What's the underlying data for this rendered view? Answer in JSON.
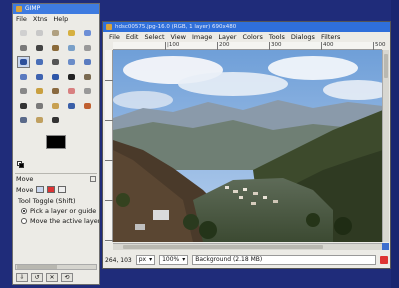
{
  "toolbox": {
    "title": "GIMP",
    "menu": [
      "File",
      "Xtns",
      "Help"
    ],
    "tools": [
      {
        "name": "rect-select-icon",
        "color": "#d0d0d0"
      },
      {
        "name": "ellipse-select-icon",
        "color": "#c8c8c8"
      },
      {
        "name": "lasso-icon",
        "color": "#b0a080"
      },
      {
        "name": "fuzzy-select-icon",
        "color": "#d6b040"
      },
      {
        "name": "select-by-color-icon",
        "color": "#6d8fd6"
      },
      {
        "name": "scissors-icon",
        "color": "#7a7a7a"
      },
      {
        "name": "paths-icon",
        "color": "#444"
      },
      {
        "name": "color-picker-icon",
        "color": "#8b6a3a"
      },
      {
        "name": "zoom-icon",
        "color": "#7aa0c8"
      },
      {
        "name": "measure-icon",
        "color": "#999"
      },
      {
        "name": "move-icon",
        "color": "#2d4f9a"
      },
      {
        "name": "align-icon",
        "color": "#4a6fb8"
      },
      {
        "name": "crop-icon",
        "color": "#555"
      },
      {
        "name": "rotate-icon",
        "color": "#6a8cc8"
      },
      {
        "name": "scale-icon",
        "color": "#5b7cc0"
      },
      {
        "name": "shear-icon",
        "color": "#5a7ac0"
      },
      {
        "name": "perspective-icon",
        "color": "#3e63b0"
      },
      {
        "name": "flip-icon",
        "color": "#2e56a8"
      },
      {
        "name": "text-icon",
        "color": "#222"
      },
      {
        "name": "bucket-fill-icon",
        "color": "#7a6a50"
      },
      {
        "name": "blend-icon",
        "color": "#888"
      },
      {
        "name": "pencil-icon",
        "color": "#c9a040"
      },
      {
        "name": "paintbrush-icon",
        "color": "#8a6a40"
      },
      {
        "name": "eraser-icon",
        "color": "#d88080"
      },
      {
        "name": "airbrush-icon",
        "color": "#999"
      },
      {
        "name": "ink-icon",
        "color": "#333"
      },
      {
        "name": "clone-icon",
        "color": "#7a7a7a"
      },
      {
        "name": "heal-icon",
        "color": "#c8a050"
      },
      {
        "name": "smudge-icon",
        "color": "#3a5fa8"
      },
      {
        "name": "dodge-burn-icon",
        "color": "#c06030"
      },
      {
        "name": "blur-icon",
        "color": "#5a6a8a"
      },
      {
        "name": "convolve-icon",
        "color": "#c0a060"
      },
      {
        "name": "paint-icon",
        "color": "#333"
      }
    ],
    "options": {
      "header": "Move",
      "tool_toggle": "Tool Toggle  (Shift)",
      "radio_1": "Pick a layer or guide",
      "radio_2": "Move the active layer"
    }
  },
  "image_window": {
    "title": "hdsc00575.jpg-16.0 (RGB, 1 layer) 690x480",
    "menu": [
      "File",
      "Edit",
      "Select",
      "View",
      "Image",
      "Layer",
      "Colors",
      "Tools",
      "Dialogs",
      "Filters"
    ],
    "ruler_labels": [
      "|100",
      "200",
      "300",
      "400",
      "500"
    ],
    "status": {
      "coords": "264, 103",
      "unit": "px",
      "zoom": "100%",
      "message": "Background (2.18 MB)"
    }
  },
  "colors": {
    "desktop": "#1f2c7a",
    "title_bar": "#2f6fda",
    "foreground": "#000000",
    "background": "#ffffff"
  }
}
